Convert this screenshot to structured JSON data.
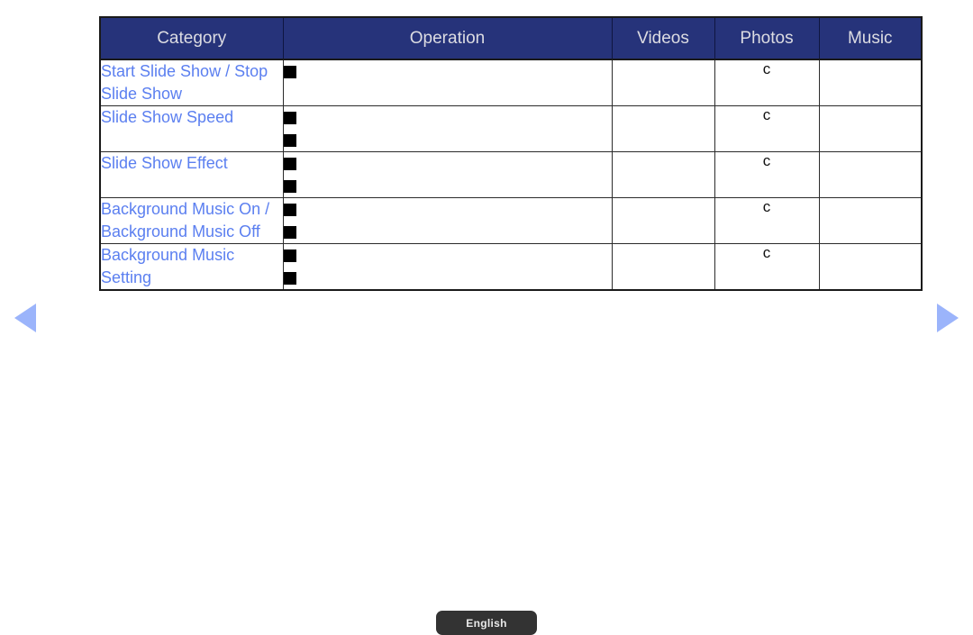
{
  "page": {
    "background_color": "#ffffff",
    "accent_header_color": "#26337a",
    "category_text_color": "#5b7ff0",
    "arrow_color": "#9bb4fb"
  },
  "nav": {
    "prev_icon": "triangle-left-icon",
    "next_icon": "triangle-right-icon"
  },
  "table": {
    "headers": [
      {
        "label": "Category"
      },
      {
        "label": "Operation"
      },
      {
        "label": "Videos"
      },
      {
        "label": "Photos"
      },
      {
        "label": "Music"
      }
    ],
    "rows": [
      {
        "category": "Start Slide Show / Stop Slide Show",
        "operations": [
          {
            "bullet": "black-square-bullet",
            "text": ""
          }
        ],
        "videos": "",
        "photos": "c",
        "music": ""
      },
      {
        "category": "Slide Show Speed",
        "operations": [
          {
            "bullet": "black-square-bullet",
            "text": ""
          },
          {
            "bullet": "black-square-bullet",
            "text": ""
          }
        ],
        "videos": "",
        "photos": "c",
        "music": ""
      },
      {
        "category": "Slide Show Effect",
        "operations": [
          {
            "bullet": "black-square-bullet",
            "text": ""
          },
          {
            "bullet": "black-square-bullet",
            "text": ""
          }
        ],
        "videos": "",
        "photos": "c",
        "music": ""
      },
      {
        "category": "Background Music On / Background Music Off",
        "operations": [
          {
            "bullet": "black-square-bullet",
            "text": ""
          },
          {
            "bullet": "black-square-bullet",
            "text": ""
          }
        ],
        "videos": "",
        "photos": "c",
        "music": ""
      },
      {
        "category": "Background Music Setting",
        "operations": [
          {
            "bullet": "black-square-bullet",
            "text": ""
          },
          {
            "bullet": "black-square-bullet",
            "text": ""
          }
        ],
        "videos": "",
        "photos": "c",
        "music": ""
      }
    ]
  },
  "footer": {
    "language_button_label": "English"
  }
}
